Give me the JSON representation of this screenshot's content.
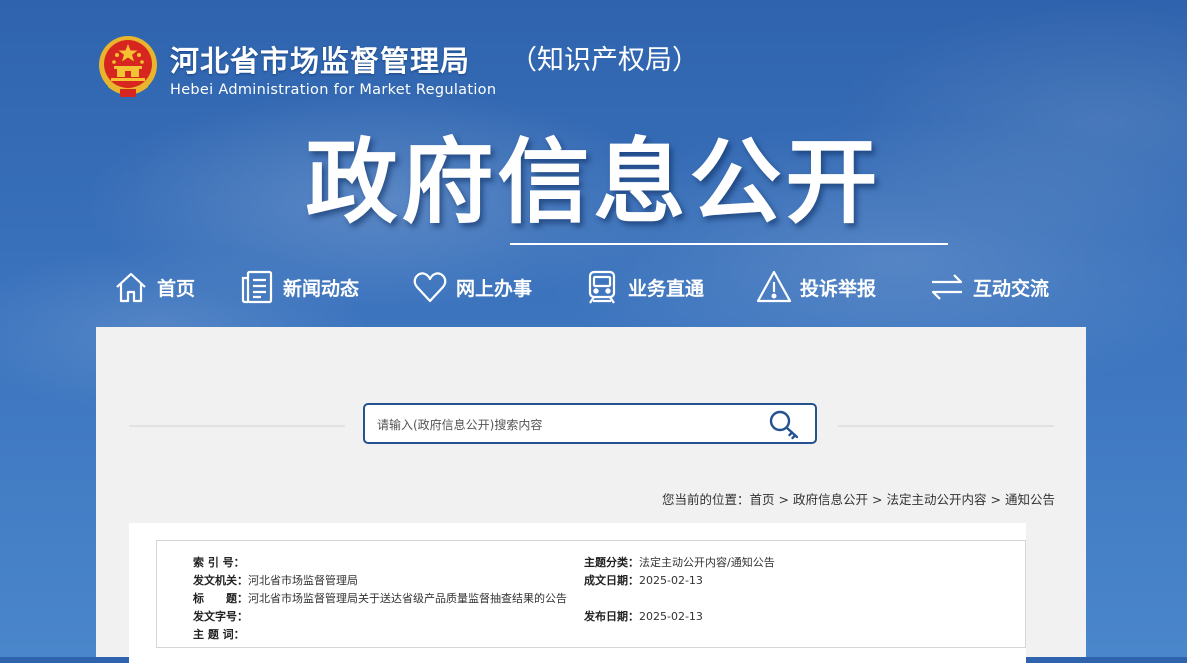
{
  "header": {
    "title": "河北省市场监督管理局",
    "title_suffix": "（知识产权局）",
    "subtitle_en": "Hebei Administration for Market Regulation",
    "section_title": "政府信息公开"
  },
  "nav": [
    {
      "label": "首页",
      "icon": "home-icon"
    },
    {
      "label": "新闻动态",
      "icon": "news-icon"
    },
    {
      "label": "网上办事",
      "icon": "heart-icon"
    },
    {
      "label": "业务直通",
      "icon": "train-icon"
    },
    {
      "label": "投诉举报",
      "icon": "warning-icon"
    },
    {
      "label": "互动交流",
      "icon": "exchange-icon"
    }
  ],
  "search": {
    "placeholder": "请输入(政府信息公开)搜索内容",
    "icon": "search-key-icon"
  },
  "breadcrumb": {
    "prefix": "您当前的位置：",
    "items": [
      "首页",
      "政府信息公开",
      "法定主动公开内容",
      "通知公告"
    ],
    "separator": ">"
  },
  "meta": {
    "index_label": "索 引 号：",
    "index_value": "",
    "category_label": "主题分类：",
    "category_value": "法定主动公开内容/通知公告",
    "issuer_label": "发文机关：",
    "issuer_value": "河北省市场监督管理局",
    "date_written_label": "成文日期：",
    "date_written_value": "2025-02-13",
    "title_label": "标　　题：",
    "title_value": "河北省市场监督管理局关于送达省级产品质量监督抽查结果的公告",
    "doc_no_label": "发文字号：",
    "doc_no_value": "",
    "publish_date_label": "发布日期：",
    "publish_date_value": "2025-02-13",
    "keywords_label": "主 题 词：",
    "keywords_value": ""
  },
  "colors": {
    "background_blue": "#3b73bd",
    "search_border": "#24528f",
    "panel_bg": "#f1f1f1",
    "emblem_red": "#d7261f",
    "emblem_gold": "#f3c333"
  }
}
